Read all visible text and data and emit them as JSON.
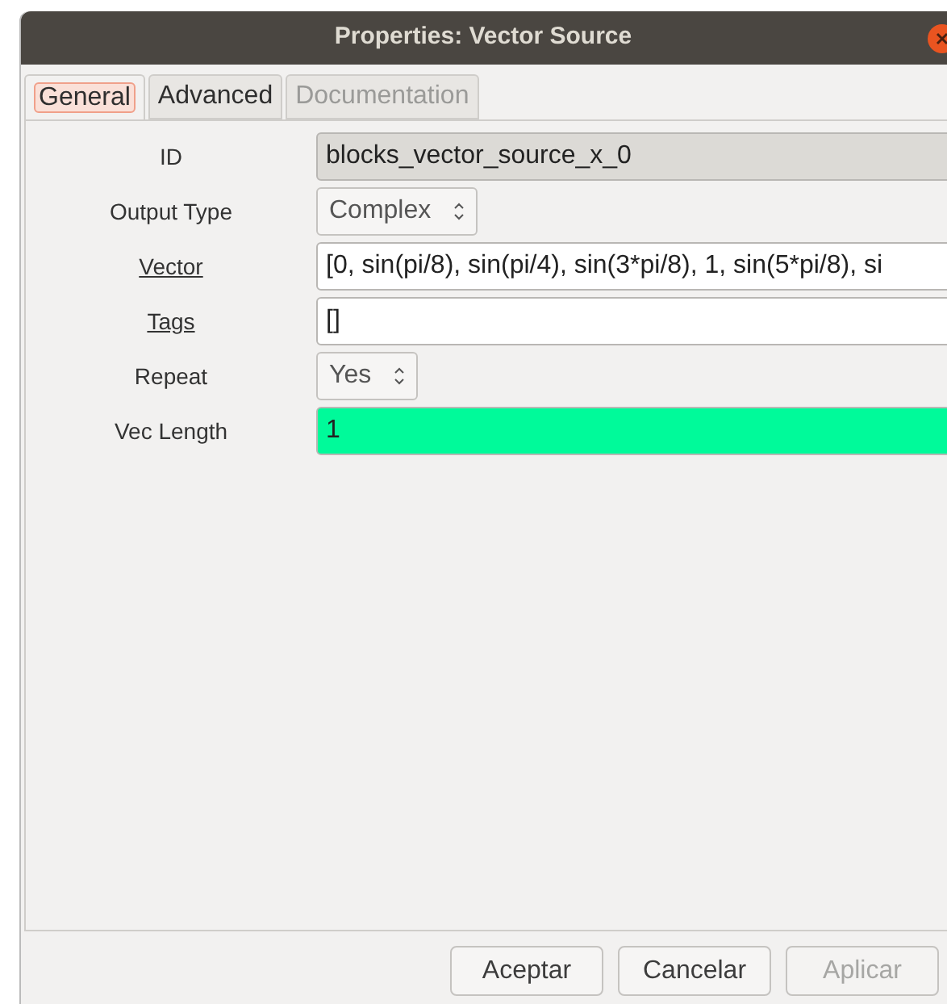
{
  "window": {
    "title": "Properties: Vector Source"
  },
  "tabs": [
    {
      "label": "General",
      "selected": true,
      "disabled": false
    },
    {
      "label": "Advanced",
      "selected": false,
      "disabled": false
    },
    {
      "label": "Documentation",
      "selected": false,
      "disabled": true
    }
  ],
  "params": [
    {
      "label": "ID",
      "underlined": false,
      "kind": "readonly",
      "value": "blocks_vector_source_x_0"
    },
    {
      "label": "Output Type",
      "underlined": false,
      "kind": "combo",
      "value": "Complex"
    },
    {
      "label": "Vector",
      "underlined": true,
      "kind": "text",
      "value": "[0, sin(pi/8), sin(pi/4), sin(3*pi/8), 1, sin(5*pi/8), si"
    },
    {
      "label": "Tags",
      "underlined": true,
      "kind": "text",
      "value": "[]"
    },
    {
      "label": "Repeat",
      "underlined": false,
      "kind": "combo",
      "value": "Yes"
    },
    {
      "label": "Vec Length",
      "underlined": false,
      "kind": "text",
      "value": "1",
      "color": "#00fa9a"
    }
  ],
  "buttons": [
    {
      "label": "Aceptar",
      "disabled": false
    },
    {
      "label": "Cancelar",
      "disabled": false
    },
    {
      "label": "Aplicar",
      "disabled": true
    }
  ]
}
